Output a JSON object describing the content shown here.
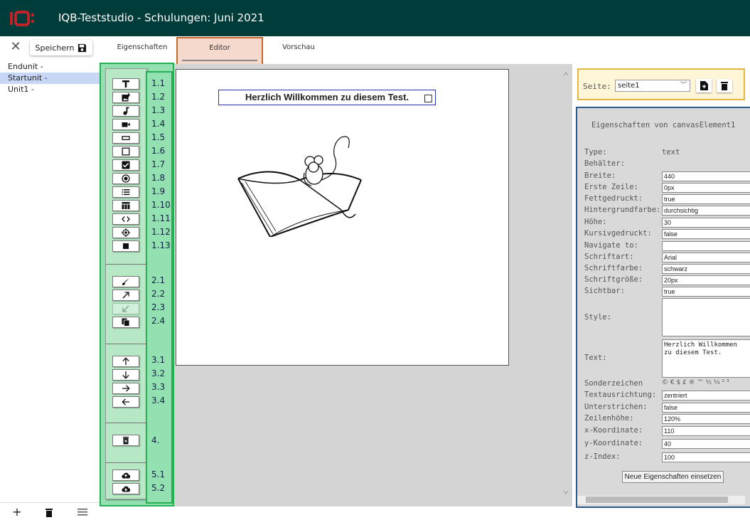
{
  "app": {
    "title": "IQB-Teststudio - Schulungen: Juni 2021",
    "logo_text": "IQB"
  },
  "toolbar": {
    "close_symbol": "✕",
    "save_label": "Speichern"
  },
  "tabs": [
    {
      "label": "Eigenschaften"
    },
    {
      "label": "Editor"
    },
    {
      "label": "Vorschau"
    }
  ],
  "units": [
    {
      "label": "Endunit -"
    },
    {
      "label": "Startunit -"
    },
    {
      "label": "Unit1 -"
    }
  ],
  "bottom_actions": {
    "add": "+",
    "delete_icon": "trash-icon",
    "menu_icon": "menu-icon"
  },
  "tool_numbers": [
    "1.1",
    "1.2",
    "1.3",
    "1.4",
    "1.5",
    "1.6",
    "1.7",
    "1.8",
    "1.9",
    "1.10",
    "1.11",
    "1.12",
    "1.13",
    "2.1",
    "2.2",
    "2.3",
    "2.4",
    "3.1",
    "3.2",
    "3.3",
    "3.4",
    "4.",
    "5.1",
    "5.2"
  ],
  "tools": [
    {
      "icon": "text-icon"
    },
    {
      "icon": "add-image-icon"
    },
    {
      "icon": "music-note-icon"
    },
    {
      "icon": "video-icon"
    },
    {
      "icon": "textfield-icon"
    },
    {
      "icon": "textarea-icon"
    },
    {
      "icon": "checkbox-icon"
    },
    {
      "icon": "radio-icon"
    },
    {
      "icon": "list-icon"
    },
    {
      "icon": "table-icon"
    },
    {
      "icon": "code-icon"
    },
    {
      "icon": "target-icon"
    },
    {
      "icon": "square-icon"
    },
    {
      "icon": "brush-icon"
    },
    {
      "icon": "arrow-up-right-icon"
    },
    {
      "icon": "arrow-down-left-icon"
    },
    {
      "icon": "copy-icon"
    },
    {
      "icon": "arrow-up-icon"
    },
    {
      "icon": "arrow-down-icon"
    },
    {
      "icon": "arrow-right-icon"
    },
    {
      "icon": "arrow-left-icon"
    },
    {
      "icon": "delete-icon"
    },
    {
      "icon": "cloud-upload-icon"
    },
    {
      "icon": "cloud-download-icon"
    }
  ],
  "canvas": {
    "text": "Herzlich Willkommen zu diesem Test."
  },
  "page_selector": {
    "label": "Seite:",
    "value": "seite1"
  },
  "properties": {
    "title": "Eigenschaften von canvasElement1",
    "type_label": "Type:",
    "type_value": "text",
    "container_label": "Behälter:",
    "rows": [
      {
        "label": "Breite:",
        "value": "440"
      },
      {
        "label": "Erste Zeile:",
        "value": "0px"
      },
      {
        "label": "Fettgedruckt:",
        "value": "true"
      },
      {
        "label": "Hintergrundfarbe:",
        "value": "durchsichtig"
      },
      {
        "label": "Höhe:",
        "value": "30"
      },
      {
        "label": "Kursivgedruckt:",
        "value": "false"
      },
      {
        "label": "Navigate to:",
        "value": ""
      },
      {
        "label": "Schriftart:",
        "value": "Arial"
      },
      {
        "label": "Schriftfarbe:",
        "value": "schwarz"
      },
      {
        "label": "Schriftgröße:",
        "value": "20px"
      },
      {
        "label": "Sichtbar:",
        "value": "true"
      }
    ],
    "style_label": "Style:",
    "text_label": "Text:",
    "text_value": "Herzlich Willkommen zu diesem Test.",
    "special_label": "Sonderzeichen",
    "special_chars": "© € $ £ ® ™ ½ ¼ ² ³",
    "rows2": [
      {
        "label": "Textausrichtung:",
        "value": "zentriert"
      },
      {
        "label": "Unterstrichen:",
        "value": "false"
      },
      {
        "label": "Zeilenhöhe:",
        "value": "120%"
      },
      {
        "label": "x-Koordinate:",
        "value": "110"
      },
      {
        "label": "y-Koordinate:",
        "value": "40"
      },
      {
        "label": "z-Index:",
        "value": "100"
      }
    ],
    "apply_label": "Neue Eigenschaften einsetzen"
  }
}
